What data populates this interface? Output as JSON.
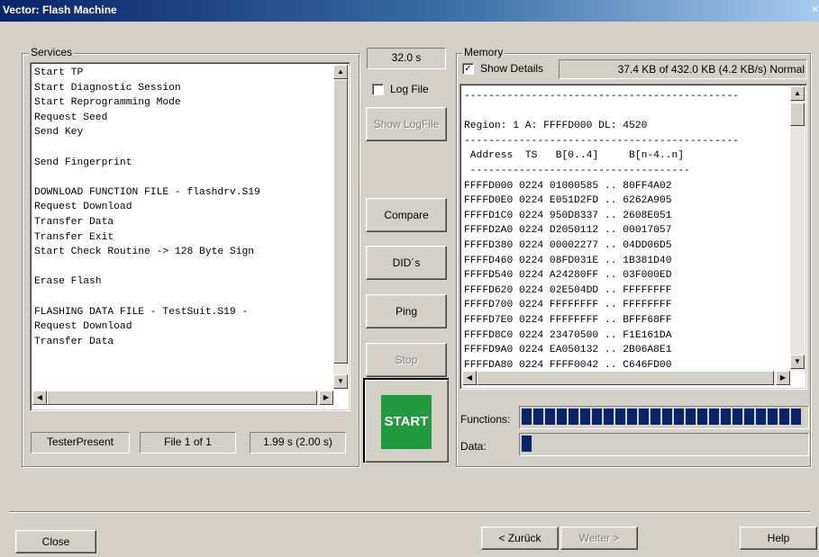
{
  "window": {
    "title": "Vector: Flash Machine"
  },
  "services": {
    "label": "Services",
    "lines": [
      "Start TP",
      "Start Diagnostic Session",
      "Start Reprogramming Mode",
      "Request Seed",
      "Send Key",
      "",
      "Send Fingerprint",
      "",
      "DOWNLOAD FUNCTION FILE - flashdrv.S19",
      "Request Download",
      "Transfer Data",
      "Transfer Exit",
      "Start Check Routine -> 128 Byte Sign",
      "",
      "Erase Flash",
      "",
      "FLASHING DATA FILE - TestSuit.S19 -",
      "Request Download",
      "Transfer Data"
    ]
  },
  "status": {
    "tester_present": "TesterPresent",
    "file_counter": "File 1 of 1",
    "elapsed": "1.99 s (2.00 s)"
  },
  "controls": {
    "timer": "32.0 s",
    "log_file_label": "Log File",
    "log_file_checked": false,
    "show_logfile": "Show LogFile",
    "compare": "Compare",
    "dids": "DID´s",
    "ping": "Ping",
    "stop": "Stop",
    "start": "START",
    "start_color": "#1f9a3c"
  },
  "memory": {
    "label": "Memory",
    "show_details_label": "Show Details",
    "show_details_checked": true,
    "summary": "37.4 KB of 432.0 KB (4.2 KB/s) Normal",
    "lines": [
      "---------------------------------------------",
      "",
      "Region: 1 A: FFFFD000 DL: 4520",
      "---------------------------------------------",
      " Address  TS   B[0..4]     B[n-4..n]",
      " ------------------------------------",
      "FFFFD000 0224 01000585 .. 80FF4A02",
      "FFFFD0E0 0224 E051D2FD .. 6262A905",
      "FFFFD1C0 0224 950D8337 .. 2608E051",
      "FFFFD2A0 0224 D2050112 .. 00017057",
      "FFFFD380 0224 00002277 .. 04DD06D5",
      "FFFFD460 0224 08FD031E .. 1B381D40",
      "FFFFD540 0224 A24280FF .. 03F000ED",
      "FFFFD620 0224 02E504DD .. FFFFFFFF",
      "FFFFD700 0224 FFFFFFFF .. FFFFFFFF",
      "FFFFD7E0 0224 FFFFFFFF .. BFFF68FF",
      "FFFFD8C0 0224 23470500 .. F1E161DA",
      "FFFFD9A0 0224 EA050132 .. 2B06A8E1",
      "FFFFDA80 0224 FFFF0042 .. C646FD00"
    ],
    "functions_label": "Functions:",
    "functions_progress": 1.0,
    "data_label": "Data:",
    "data_progress": 0.08,
    "bar_color": "#0a246a"
  },
  "footer": {
    "close": "Close",
    "back": "< Zurück",
    "next": "Weiter >",
    "help": "Help"
  }
}
